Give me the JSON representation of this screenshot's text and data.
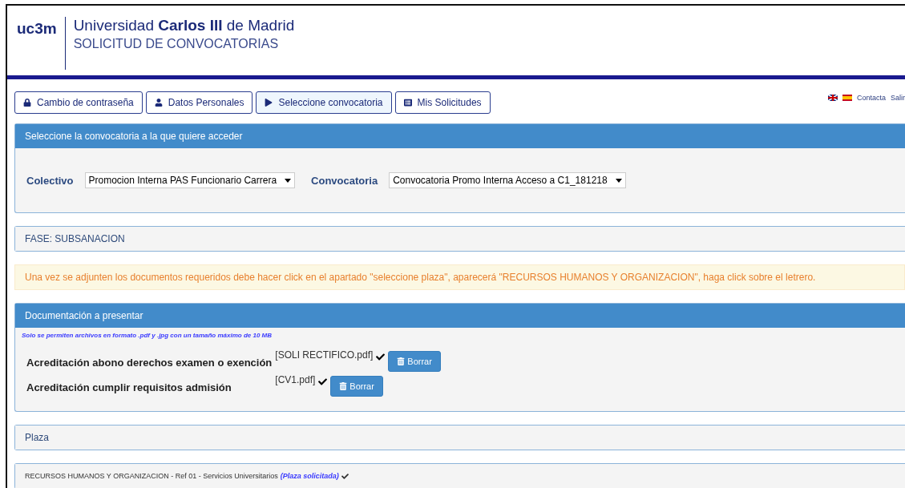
{
  "header": {
    "logo": "uc3m",
    "university": "Universidad **Carlos III** de Madrid",
    "subtitle": "SOLICITUD DE CONVOCATORIAS"
  },
  "top_links": [
    "Contacta",
    "Salir"
  ],
  "nav": [
    {
      "label": "Cambio de contraseña",
      "selected": false
    },
    {
      "label": "Datos Personales",
      "selected": false
    },
    {
      "label": "Seleccione convocatoria",
      "selected": true
    },
    {
      "label": "Mis Solicitudes",
      "selected": false
    }
  ],
  "selection_panel": {
    "title": "Seleccione la convocatoria a la que quiere acceder",
    "fields": [
      {
        "label": "Colectivo",
        "value": "Promocion Interna PAS Funcionario Carrera"
      },
      {
        "label": "Convocatoria",
        "value": "Convocatoria Promo Interna Acceso a C1_181218"
      }
    ]
  },
  "phase": "FASE: SUBSANACION",
  "alert": "Una vez se adjunten los documentos requeridos debe hacer click en el apartado \"seleccione plaza\", aparecerá \"RECURSOS HUMANOS Y ORGANIZACION\", haga click sobre el letrero.",
  "documents_panel": {
    "title": "Documentación a presentar",
    "note": "Solo se permiten archivos en formato .pdf y .jpg con un tamaño máximo de 10 MB",
    "documents": [
      {
        "label": "Acreditación abono derechos examen o exención",
        "file": "[SOLI RECTIFICO.pdf]",
        "uploaded": true,
        "button": "Borrar"
      },
      {
        "label": "Acreditación cumplir requisitos admisión",
        "file": "[CV1.pdf]",
        "uploaded": true,
        "button": "Borrar"
      }
    ]
  },
  "plaza_panel": {
    "title": "Plaza"
  },
  "plaza_item": {
    "text": "RECURSOS HUMANOS Y ORGANIZACION - Ref 01 - Servicios Universitarios",
    "status": "(Plaza solicitada)",
    "confirmed": true
  }
}
